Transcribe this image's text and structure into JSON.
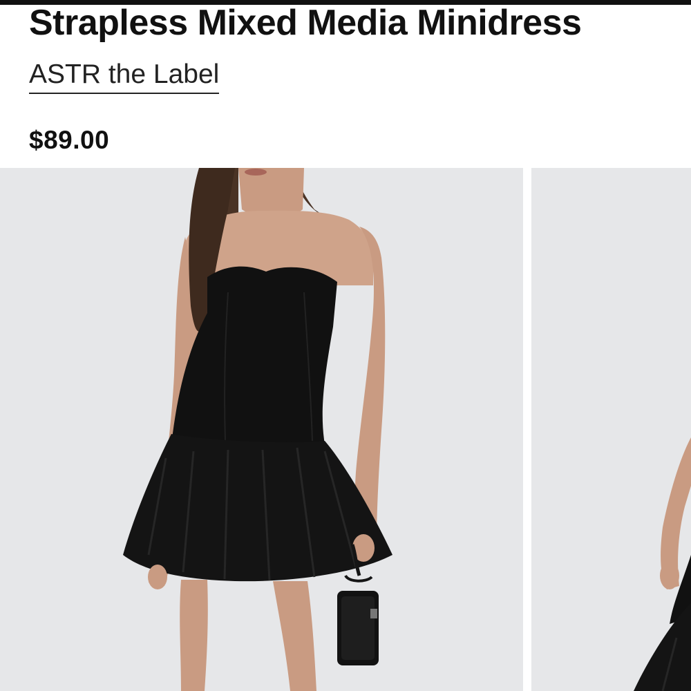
{
  "product": {
    "title": "Strapless Mixed Media Minidress",
    "brand": "ASTR the Label",
    "price": "$89.00"
  },
  "gallery": {
    "images": [
      {
        "name": "product-image-front"
      },
      {
        "name": "product-image-side"
      }
    ]
  },
  "colors": {
    "text": "#111111",
    "photo_background": "#e6e7e9",
    "dress": "#111111"
  }
}
